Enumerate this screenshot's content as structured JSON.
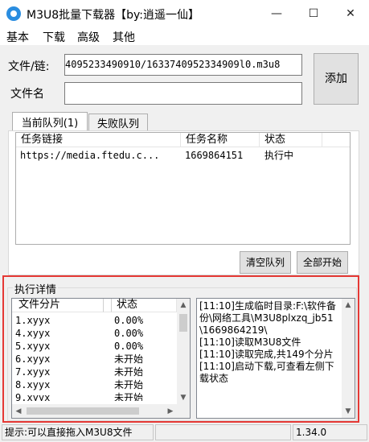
{
  "window": {
    "title": "M3U8批量下载器【by:逍遥一仙】",
    "minimize_glyph": "—",
    "maximize_glyph": "☐",
    "close_glyph": "✕",
    "icon": "app-disc-icon"
  },
  "menu": {
    "items": [
      "基本",
      "下载",
      "高级",
      "其他"
    ]
  },
  "form": {
    "file_link_label": "文件/链:",
    "file_link_value": "4095233490910/1633740952334909l0.m3u8",
    "file_name_label": "文件名",
    "file_name_value": "",
    "add_button": "添加"
  },
  "tabs": [
    {
      "label": "当前队列(1)",
      "active": true
    },
    {
      "label": "失败队列",
      "active": false
    }
  ],
  "queue": {
    "columns": [
      "任务链接",
      "任务名称",
      "状态"
    ],
    "rows": [
      {
        "link": "https://media.ftedu.c...",
        "name": "1669864151",
        "status": "执行中"
      }
    ],
    "clear_button": "清空队列",
    "start_all_button": "全部开始"
  },
  "exec": {
    "title": "执行详情",
    "segments": {
      "columns": [
        "文件分片",
        "状态"
      ],
      "rows": [
        {
          "file": "1.xyyx",
          "status": "0.00%"
        },
        {
          "file": "4.xyyx",
          "status": "0.00%"
        },
        {
          "file": "5.xyyx",
          "status": "0.00%"
        },
        {
          "file": "6.xyyx",
          "status": "未开始"
        },
        {
          "file": "7.xyyx",
          "status": "未开始"
        },
        {
          "file": "8.xyyx",
          "status": "未开始"
        },
        {
          "file": "9.xyyx",
          "status": "未开始"
        }
      ]
    },
    "log": "[11:10]生成临时目录:F:\\软件备份\\网络工具\\M3U8plxzq_jb51\\1669864219\\\n[11:10]读取M3U8文件\n[11:10]读取完成,共149个分片\n[11:10]启动下载,可查看左侧下载状态"
  },
  "status": {
    "hint": "提示:可以直接拖入M3U8文件",
    "version": "1.34.0"
  },
  "colors": {
    "highlight": "#e53935",
    "app_icon": "#2a8de0"
  }
}
